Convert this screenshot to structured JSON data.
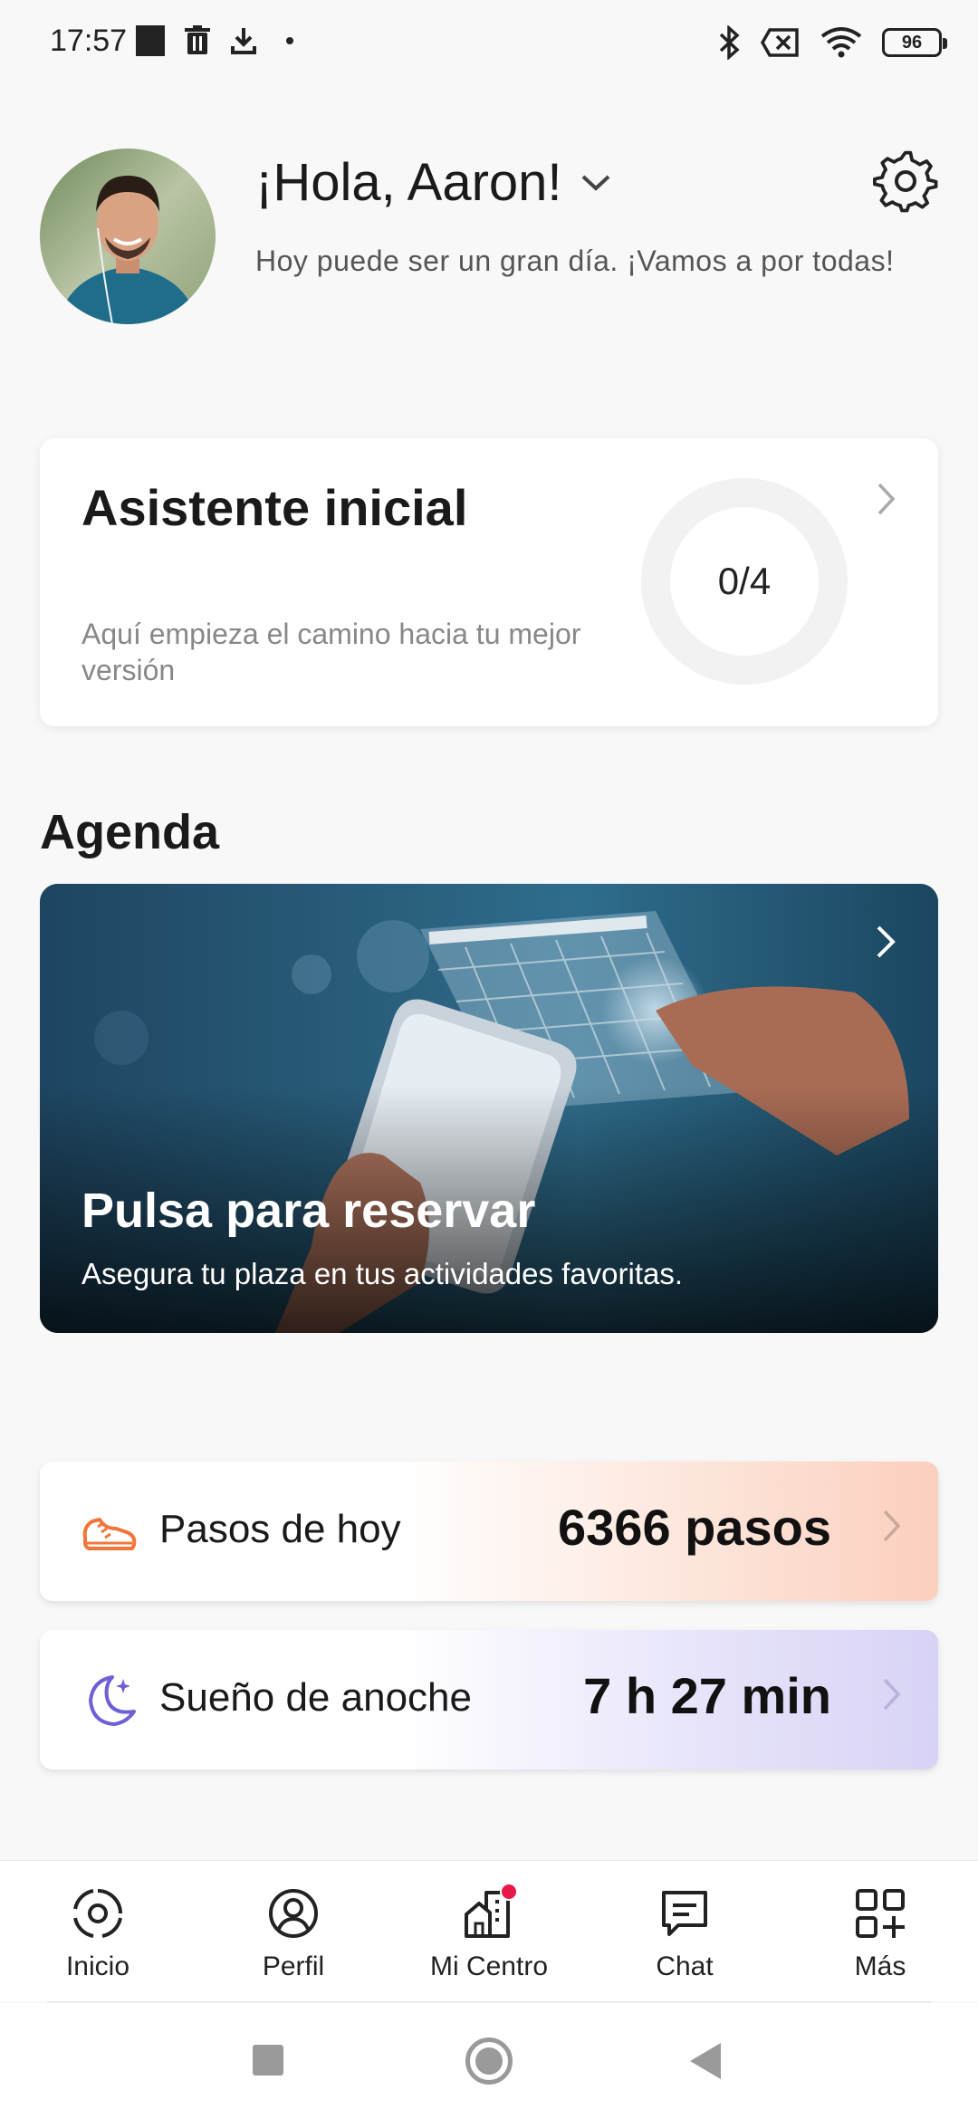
{
  "status_bar": {
    "time": "17:57",
    "battery": "96",
    "icons_left": [
      "app-square-icon",
      "trash-icon",
      "download-icon",
      "dot-icon"
    ],
    "icons_right": [
      "bluetooth-icon",
      "no-sim-icon",
      "wifi-icon",
      "battery-icon"
    ]
  },
  "header": {
    "greeting": "¡Hola, Aaron!",
    "subtitle": "Hoy puede ser un gran día. ¡Vamos a por todas!",
    "settings_icon": "gear-icon"
  },
  "assistant": {
    "title": "Asistente inicial",
    "subtitle": "Aquí empieza el camino hacia tu mejor versión",
    "progress_label": "0/4",
    "progress_completed": 0,
    "progress_total": 4
  },
  "agenda": {
    "section_title": "Agenda",
    "banner_title": "Pulsa para reservar",
    "banner_subtitle": "Asegura tu plaza en tus actividades favoritas."
  },
  "metrics": {
    "steps": {
      "label": "Pasos de hoy",
      "value": "6366 pasos",
      "icon": "shoe-icon",
      "accent": "#f0763a"
    },
    "sleep": {
      "label": "Sueño de anoche",
      "value": "7 h 27 min",
      "icon": "moon-icon",
      "accent": "#6d5fd6"
    }
  },
  "bottom_nav": {
    "items": [
      {
        "label": "Inicio",
        "icon": "home-target-icon"
      },
      {
        "label": "Perfil",
        "icon": "profile-icon"
      },
      {
        "label": "Mi Centro",
        "icon": "building-icon",
        "badge": true
      },
      {
        "label": "Chat",
        "icon": "chat-icon"
      },
      {
        "label": "Más",
        "icon": "more-grid-icon"
      }
    ]
  },
  "colors": {
    "badge": "#e8174a",
    "background": "#f8f8f8"
  }
}
